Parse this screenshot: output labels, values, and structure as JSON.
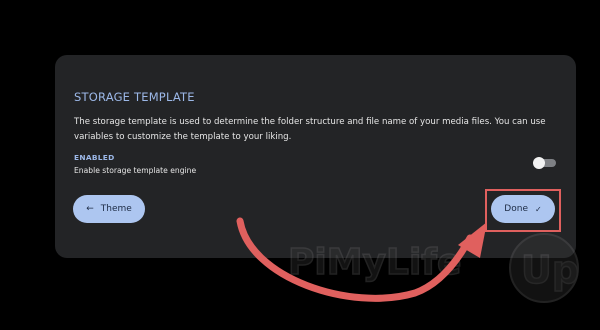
{
  "card": {
    "title": "STORAGE TEMPLATE",
    "description": "The storage template is used to determine the folder structure and file name of your media files. You can use variables to customize the template to your liking."
  },
  "setting": {
    "label": "ENABLED",
    "description": "Enable storage template engine",
    "toggle_on": false
  },
  "buttons": {
    "theme_icon": "←",
    "theme_label": "Theme",
    "done_label": "Done",
    "done_icon": "✓"
  },
  "watermark": {
    "text": "PiMyLifeUp"
  },
  "colors": {
    "background": "#000000",
    "card": "#232426",
    "accent": "#9cb8e8",
    "button": "#adc6f0",
    "annotation": "#e0605e"
  }
}
